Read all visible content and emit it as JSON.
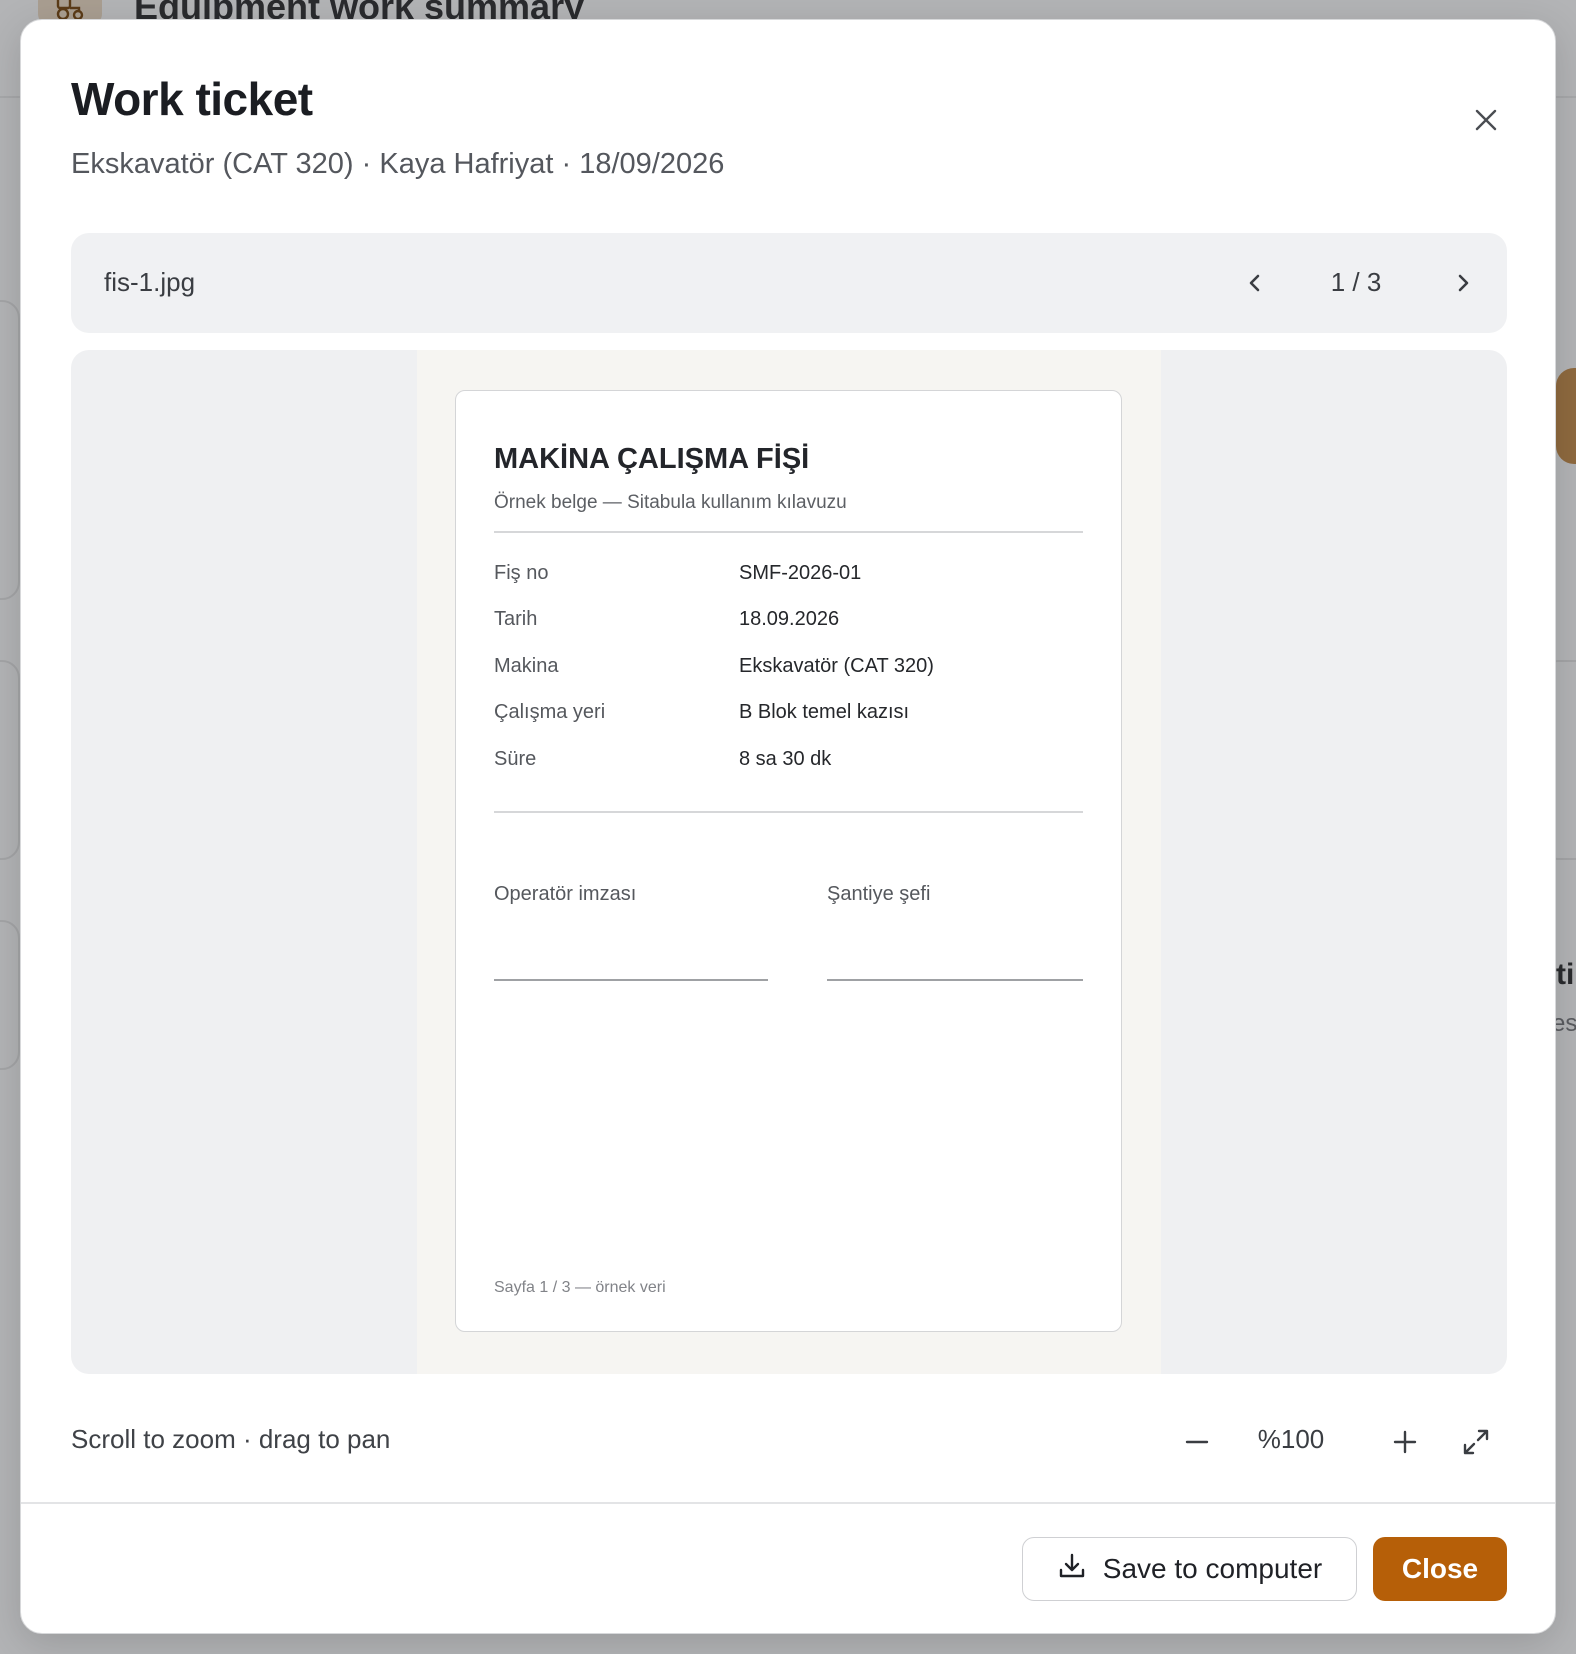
{
  "background": {
    "header_title": "Equipment work summary",
    "header_icon": "tractor-icon",
    "fragment_title": "ti",
    "fragment_sub": "es"
  },
  "modal": {
    "title": "Work ticket",
    "subtitle": "Ekskavatör (CAT 320) · Kaya Hafriyat · 18/09/2026",
    "close_icon": "close-icon"
  },
  "file_bar": {
    "file_name": "fis-1.jpg",
    "page_indicator": "1 / 3",
    "prev_icon": "chevron-left-icon",
    "next_icon": "chevron-right-icon"
  },
  "document": {
    "title": "MAKİNA ÇALIŞMA FİŞİ",
    "subtitle": "Örnek belge — Sitabula kullanım kılavuzu",
    "rows": [
      {
        "label": "Fiş no",
        "value": "SMF-2026-01"
      },
      {
        "label": "Tarih",
        "value": "18.09.2026"
      },
      {
        "label": "Makina",
        "value": "Ekskavatör (CAT 320)"
      },
      {
        "label": "Çalışma yeri",
        "value": "B Blok temel kazısı"
      },
      {
        "label": "Süre",
        "value": "8 sa 30 dk"
      }
    ],
    "signature_operator": "Operatör imzası",
    "signature_chief": "Şantiye şefi",
    "footer": "Sayfa 1 / 3 — örnek veri"
  },
  "controls": {
    "hint": "Scroll to zoom · drag to pan",
    "zoom_level": "%100",
    "zoom_out_icon": "minus-icon",
    "zoom_in_icon": "plus-icon",
    "fullscreen_icon": "expand-icon"
  },
  "footer": {
    "save_label": "Save to computer",
    "save_icon": "download-icon",
    "close_label": "Close"
  },
  "colors": {
    "accent": "#b65f08",
    "backdrop": "#b3b4b6",
    "panel": "#f0f1f3"
  }
}
